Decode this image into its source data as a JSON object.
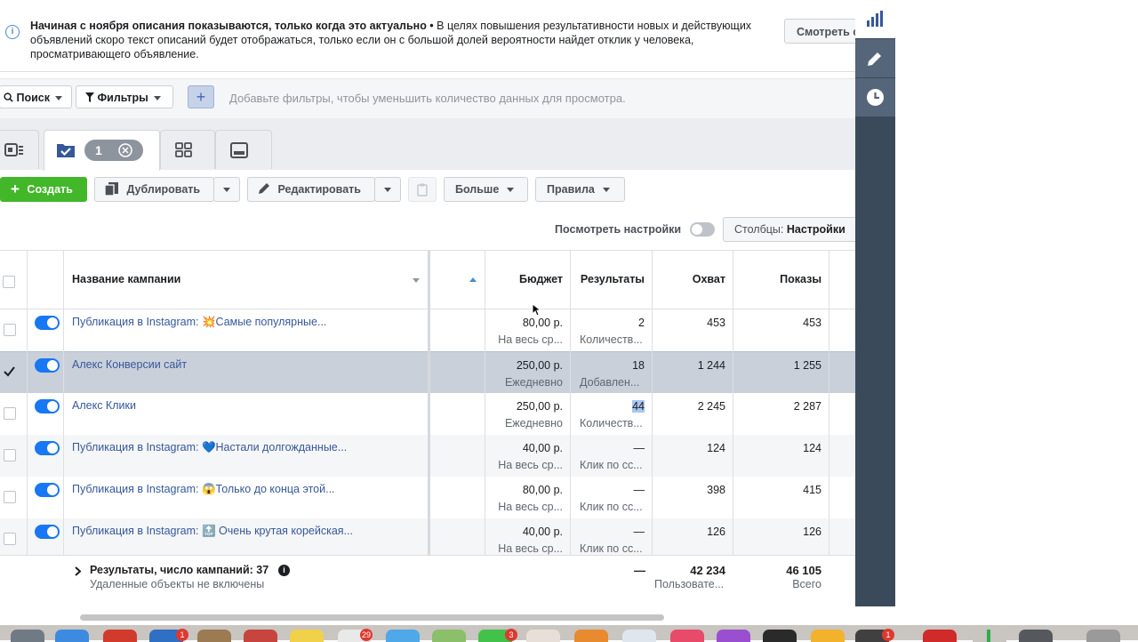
{
  "notice": {
    "bold_text": "Начиная с ноября описания показываются, только когда это актуально •",
    "text": " В целях повышения результативности новых и действующих объявлений скоро текст описаний будет отображаться, только если он с большой долей вероятности найдет отклик у человека, просматривающего объявление.",
    "button": "Смотреть с"
  },
  "filters": {
    "search_label": "Поиск",
    "filters_label": "Фильтры",
    "add_filter_icon": "+",
    "hint": "Добавьте фильтры, чтобы уменьшить количество данных для просмотра."
  },
  "tabs": {
    "selected_count": "1"
  },
  "toolbar": {
    "create_label": "Создать",
    "duplicate_label": "Дублировать",
    "edit_label": "Редактировать",
    "more_label": "Больше",
    "rules_label": "Правила"
  },
  "settings": {
    "view_settings_label": "Посмотреть настройки",
    "columns_prefix": "Столбцы:",
    "columns_value": "Настройки"
  },
  "table": {
    "headers": {
      "name": "Название кампании",
      "budget": "Бюджет",
      "results": "Результаты",
      "reach": "Охват",
      "impressions": "Показы"
    },
    "rows": [
      {
        "name": "Публикация в Instagram: 💥Самые популярные...",
        "budget": "80,00 р.",
        "budget_sub": "На весь ср...",
        "results": "2",
        "results_sub": "Количеств...",
        "reach": "453",
        "impressions": "453",
        "checked": false
      },
      {
        "name": "Алекс Конверсии сайт",
        "budget": "250,00 р.",
        "budget_sub": "Ежедневно",
        "results": "18",
        "results_sub": "Добавлен...",
        "reach": "1 244",
        "impressions": "1 255",
        "checked": true
      },
      {
        "name": "Алекс Клики",
        "budget": "250,00 р.",
        "budget_sub": "Ежедневно",
        "results": "44",
        "results_sub": "Количеств...",
        "reach": "2 245",
        "impressions": "2 287",
        "checked": false
      },
      {
        "name": "Публикация в Instagram: 💙Настали долгожданные...",
        "budget": "40,00 р.",
        "budget_sub": "На весь ср...",
        "results": "—",
        "results_sub": "Клик по сс...",
        "reach": "124",
        "impressions": "124",
        "checked": false
      },
      {
        "name": "Публикация в Instagram: 😱Только до конца этой...",
        "budget": "80,00 р.",
        "budget_sub": "На весь ср...",
        "results": "—",
        "results_sub": "Клик по сс...",
        "reach": "398",
        "impressions": "415",
        "checked": false
      },
      {
        "name": "Публикация в Instagram: 🔝 Очень крутая корейская...",
        "budget": "40,00 р.",
        "budget_sub": "На весь ср...",
        "results": "—",
        "results_sub": "Клик по сс...",
        "reach": "126",
        "impressions": "126",
        "checked": false
      }
    ],
    "footer": {
      "title": "Результаты, число кампаний: 37",
      "subtitle": "Удаленные объекты не включены",
      "results": "—",
      "reach": "42 234",
      "reach_sub": "Пользовате...",
      "impressions": "46 105",
      "impressions_sub": "Всего"
    }
  },
  "dock": {
    "badges": [
      "1",
      "29",
      "3",
      "1"
    ]
  },
  "colors": {
    "accent": "#1877f2",
    "create_green": "#42b72a",
    "sidebar": "#3b4a5a",
    "selected_row": "#c9d0da"
  }
}
